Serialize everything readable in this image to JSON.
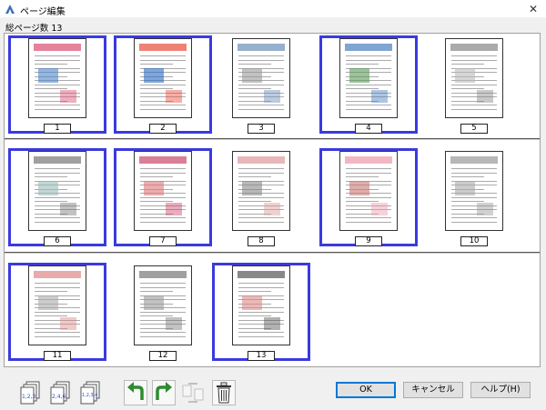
{
  "window": {
    "title": "ページ編集",
    "close_glyph": "✕"
  },
  "page_count": {
    "label": "総ページ数",
    "value": "13"
  },
  "pages": [
    {
      "num": "1",
      "selected": true
    },
    {
      "num": "2",
      "selected": true
    },
    {
      "num": "3",
      "selected": false
    },
    {
      "num": "4",
      "selected": true
    },
    {
      "num": "5",
      "selected": false
    },
    {
      "num": "6",
      "selected": true
    },
    {
      "num": "7",
      "selected": true
    },
    {
      "num": "8",
      "selected": false
    },
    {
      "num": "9",
      "selected": true
    },
    {
      "num": "10",
      "selected": false
    },
    {
      "num": "11",
      "selected": true
    },
    {
      "num": "12",
      "selected": false
    },
    {
      "num": "13",
      "selected": true
    }
  ],
  "toolbar": {
    "sort_123_label": "1,2,3",
    "sort_246_label": "2,4,6",
    "sort_1234_label": "1,2,3,4",
    "icons": [
      "sort-sequential-icon",
      "sort-even-icon",
      "sort-grid-icon",
      "rotate-left-icon",
      "rotate-right-icon",
      "swap-icon",
      "trash-icon"
    ]
  },
  "buttons": {
    "ok": "OK",
    "cancel": "キャンセル",
    "help": "ヘルプ(H)"
  },
  "colors": {
    "selection": "#3a3adf",
    "rotate_arrow": "#2e8b2e"
  }
}
